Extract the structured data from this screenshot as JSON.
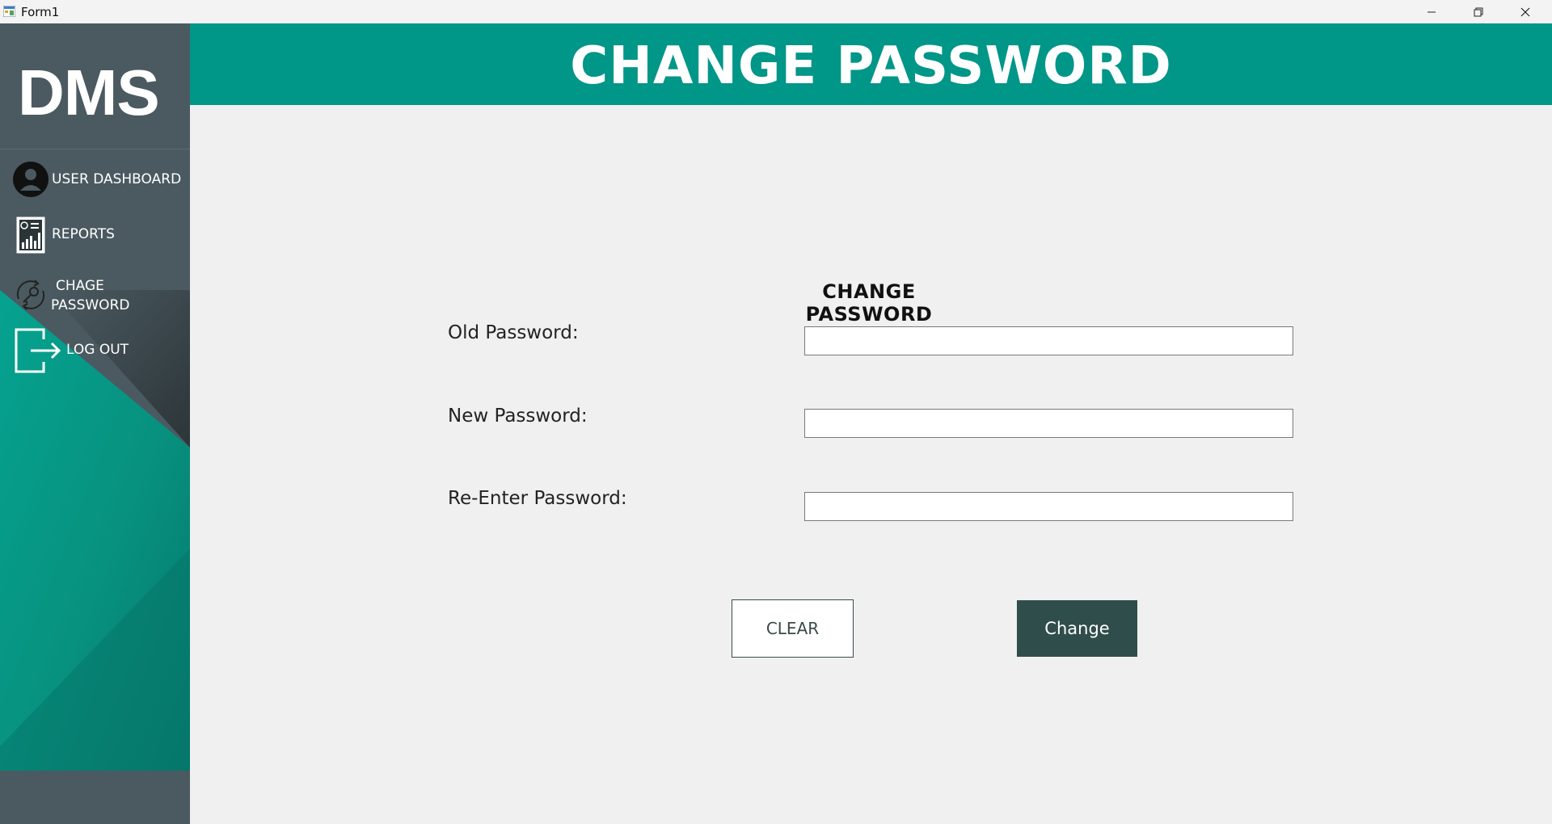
{
  "window": {
    "title": "Form1",
    "app_icon": "form-app-icon",
    "controls": [
      "minimize-icon",
      "restore-icon",
      "close-icon"
    ]
  },
  "sidebar": {
    "logo": "DMS",
    "items": [
      {
        "label": "USER DASHBOARD",
        "icon": "user-avatar-icon"
      },
      {
        "label": "REPORTS",
        "icon": "report-chart-icon"
      },
      {
        "label_line1": "CHAGE",
        "label_line2": "PASSWORD",
        "icon": "key-refresh-icon"
      },
      {
        "label": "LOG OUT",
        "icon": "logout-icon"
      }
    ]
  },
  "header": {
    "title": "CHANGE PASSWORD"
  },
  "form": {
    "heading": "CHANGE PASSWORD",
    "fields": [
      {
        "label": "Old Password:",
        "value": ""
      },
      {
        "label": "New Password:",
        "value": ""
      },
      {
        "label": "Re-Enter Password:",
        "value": ""
      }
    ],
    "clear_label": "CLEAR",
    "change_label": "Change"
  },
  "colors": {
    "accent": "#009688",
    "sidebar": "#4b5a61",
    "button_dark": "#2f4d4b",
    "background": "#f0f0f0"
  }
}
